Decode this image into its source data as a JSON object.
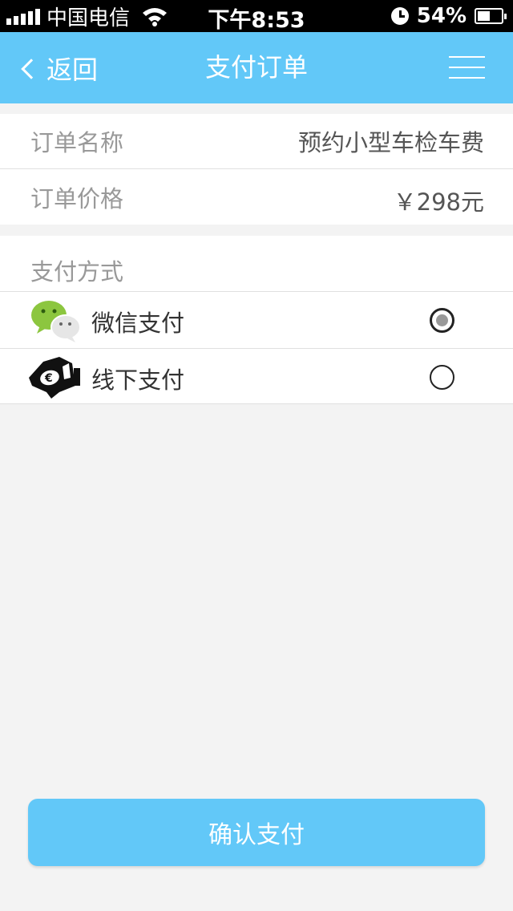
{
  "status_bar": {
    "carrier": "中国电信",
    "time": "下午8:53",
    "battery": "54%",
    "battery_level": 0.54
  },
  "nav": {
    "back_label": "返回",
    "title": "支付订单"
  },
  "order": {
    "name_label": "订单名称",
    "name_value": "预约小型车检车费",
    "price_label": "订单价格",
    "price_value": "￥298元"
  },
  "payment": {
    "section_title": "支付方式",
    "methods": [
      {
        "label": "微信支付",
        "icon": "wechat-icon",
        "selected": true
      },
      {
        "label": "线下支付",
        "icon": "offline-payment-icon",
        "selected": false
      }
    ]
  },
  "confirm_label": "确认支付",
  "colors": {
    "accent": "#62c8f8",
    "background": "#f3f3f3"
  }
}
